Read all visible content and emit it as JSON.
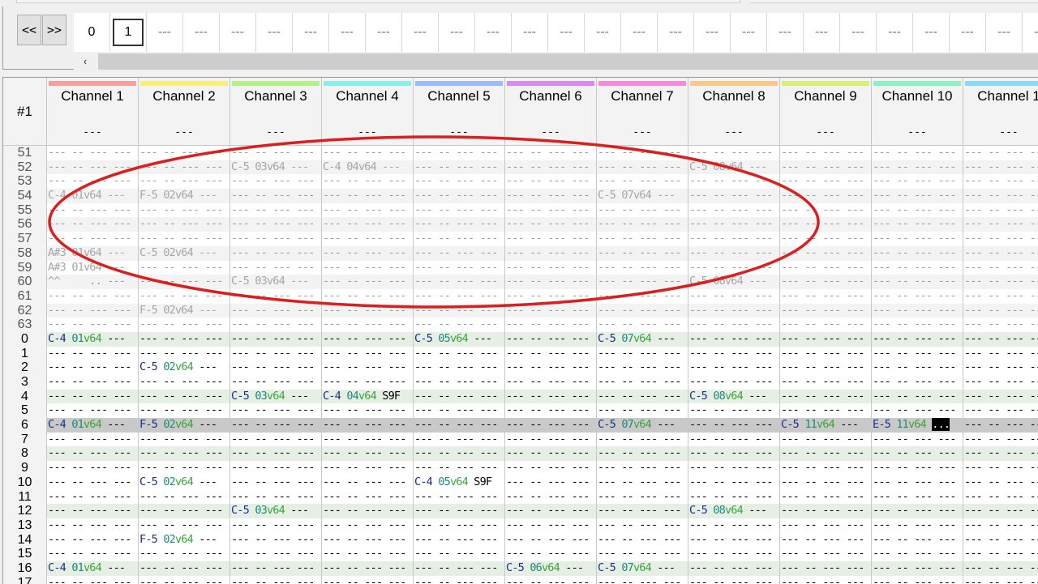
{
  "nav": {
    "prev_label": "<<",
    "next_label": ">>"
  },
  "orders": [
    "0",
    "1",
    "---",
    "---",
    "---",
    "---",
    "---",
    "---",
    "---",
    "---",
    "---",
    "---",
    "---",
    "---",
    "---",
    "---",
    "---",
    "---",
    "---",
    "---",
    "---",
    "---",
    "---",
    "---",
    "---",
    "---",
    "---"
  ],
  "order_selected_index": 1,
  "scroll_left_label": "‹",
  "pattern": {
    "corner_label": "#1",
    "channels": [
      {
        "name": "Channel 1",
        "sub": "---",
        "color": "#f4a0a0"
      },
      {
        "name": "Channel 2",
        "sub": "---",
        "color": "#f4f07a"
      },
      {
        "name": "Channel 3",
        "sub": "---",
        "color": "#b4f08c"
      },
      {
        "name": "Channel 4",
        "sub": "---",
        "color": "#88f0e8"
      },
      {
        "name": "Channel 5",
        "sub": "---",
        "color": "#9cbcf8"
      },
      {
        "name": "Channel 6",
        "sub": "---",
        "color": "#d88cf0"
      },
      {
        "name": "Channel 7",
        "sub": "---",
        "color": "#f48cd8"
      },
      {
        "name": "Channel 8",
        "sub": "---",
        "color": "#f8c88c"
      },
      {
        "name": "Channel 9",
        "sub": "---",
        "color": "#d8f07a"
      },
      {
        "name": "Channel 10",
        "sub": "---",
        "color": "#8cf0c8"
      },
      {
        "name": "Channel 1",
        "sub": "---",
        "color": "#8cd8f8"
      }
    ],
    "rows": [
      {
        "num": "51",
        "style": "prev",
        "cells": {}
      },
      {
        "num": "52",
        "style": "prev alt",
        "cells": {
          "2": [
            "C-5",
            "03",
            "v64",
            "---"
          ],
          "3": [
            "C-4",
            "04",
            "v64",
            "---"
          ],
          "7": [
            "C-5",
            "08",
            "v64",
            "---"
          ]
        }
      },
      {
        "num": "53",
        "style": "prev",
        "cells": {}
      },
      {
        "num": "54",
        "style": "prev alt",
        "cells": {
          "0": [
            "C-4",
            "01",
            "v64",
            "---"
          ],
          "1": [
            "F-5",
            "02",
            "v64",
            "---"
          ],
          "6": [
            "C-5",
            "07",
            "v64",
            "---"
          ]
        }
      },
      {
        "num": "55",
        "style": "prev",
        "cells": {}
      },
      {
        "num": "56",
        "style": "prev alt",
        "cells": {}
      },
      {
        "num": "57",
        "style": "prev",
        "cells": {}
      },
      {
        "num": "58",
        "style": "prev alt",
        "cells": {
          "0": [
            "A#3",
            "01",
            "v64",
            "---"
          ],
          "1": [
            "C-5",
            "02",
            "v64",
            "---"
          ]
        }
      },
      {
        "num": "59",
        "style": "prev",
        "cells": {
          "0": [
            "A#3",
            "01",
            "v64",
            "---"
          ]
        }
      },
      {
        "num": "60",
        "style": "prev alt",
        "cells": {
          "0": [
            "^^",
            "",
            "",
            ""
          ],
          "2": [
            "C-5",
            "03",
            "v64",
            "---"
          ],
          "7": [
            "C-5",
            "08",
            "v64",
            "---"
          ]
        }
      },
      {
        "num": "61",
        "style": "prev",
        "cells": {}
      },
      {
        "num": "62",
        "style": "prev alt",
        "cells": {
          "1": [
            "F-5",
            "02",
            "v64",
            "---"
          ]
        }
      },
      {
        "num": "63",
        "style": "prev",
        "cells": {}
      },
      {
        "num": "0",
        "style": "beat",
        "cells": {
          "0": [
            "C-4",
            "01",
            "v64",
            "---"
          ],
          "4": [
            "C-5",
            "05",
            "v64",
            "---"
          ],
          "6": [
            "C-5",
            "07",
            "v64",
            "---"
          ]
        }
      },
      {
        "num": "1",
        "style": "",
        "cells": {}
      },
      {
        "num": "2",
        "style": "",
        "cells": {
          "1": [
            "C-5",
            "02",
            "v64",
            "---"
          ]
        }
      },
      {
        "num": "3",
        "style": "",
        "cells": {}
      },
      {
        "num": "4",
        "style": "beat",
        "cells": {
          "2": [
            "C-5",
            "03",
            "v64",
            "---"
          ],
          "3": [
            "C-4",
            "04",
            "v64",
            "S9F"
          ],
          "7": [
            "C-5",
            "08",
            "v64",
            "---"
          ]
        }
      },
      {
        "num": "5",
        "style": "",
        "cells": {}
      },
      {
        "num": "6",
        "style": "cursor",
        "cells": {
          "0": [
            "C-4",
            "01",
            "v64",
            "---"
          ],
          "1": [
            "F-5",
            "02",
            "v64",
            "---"
          ],
          "6": [
            "C-5",
            "07",
            "v64",
            "---"
          ],
          "8": [
            "C-5",
            "11",
            "v64",
            "---"
          ],
          "9": [
            "E-5",
            "11",
            "v64",
            "..."
          ]
        }
      },
      {
        "num": "7",
        "style": "",
        "cells": {}
      },
      {
        "num": "8",
        "style": "beat",
        "cells": {}
      },
      {
        "num": "9",
        "style": "",
        "cells": {}
      },
      {
        "num": "10",
        "style": "",
        "cells": {
          "1": [
            "C-5",
            "02",
            "v64",
            "---"
          ],
          "4": [
            "C-4",
            "05",
            "v64",
            "S9F"
          ]
        }
      },
      {
        "num": "11",
        "style": "",
        "cells": {}
      },
      {
        "num": "12",
        "style": "beat",
        "cells": {
          "2": [
            "C-5",
            "03",
            "v64",
            "---"
          ],
          "7": [
            "C-5",
            "08",
            "v64",
            "---"
          ]
        }
      },
      {
        "num": "13",
        "style": "",
        "cells": {}
      },
      {
        "num": "14",
        "style": "",
        "cells": {
          "1": [
            "F-5",
            "02",
            "v64",
            "---"
          ]
        }
      },
      {
        "num": "15",
        "style": "",
        "cells": {}
      },
      {
        "num": "16",
        "style": "beat",
        "cells": {
          "0": [
            "C-4",
            "01",
            "v64",
            "---"
          ],
          "5": [
            "C-5",
            "06",
            "v64",
            "---"
          ],
          "6": [
            "C-5",
            "07",
            "v64",
            "---"
          ]
        }
      },
      {
        "num": "17",
        "style": "",
        "cells": {}
      }
    ]
  },
  "annotation": {
    "color": "#dc1e1e"
  }
}
